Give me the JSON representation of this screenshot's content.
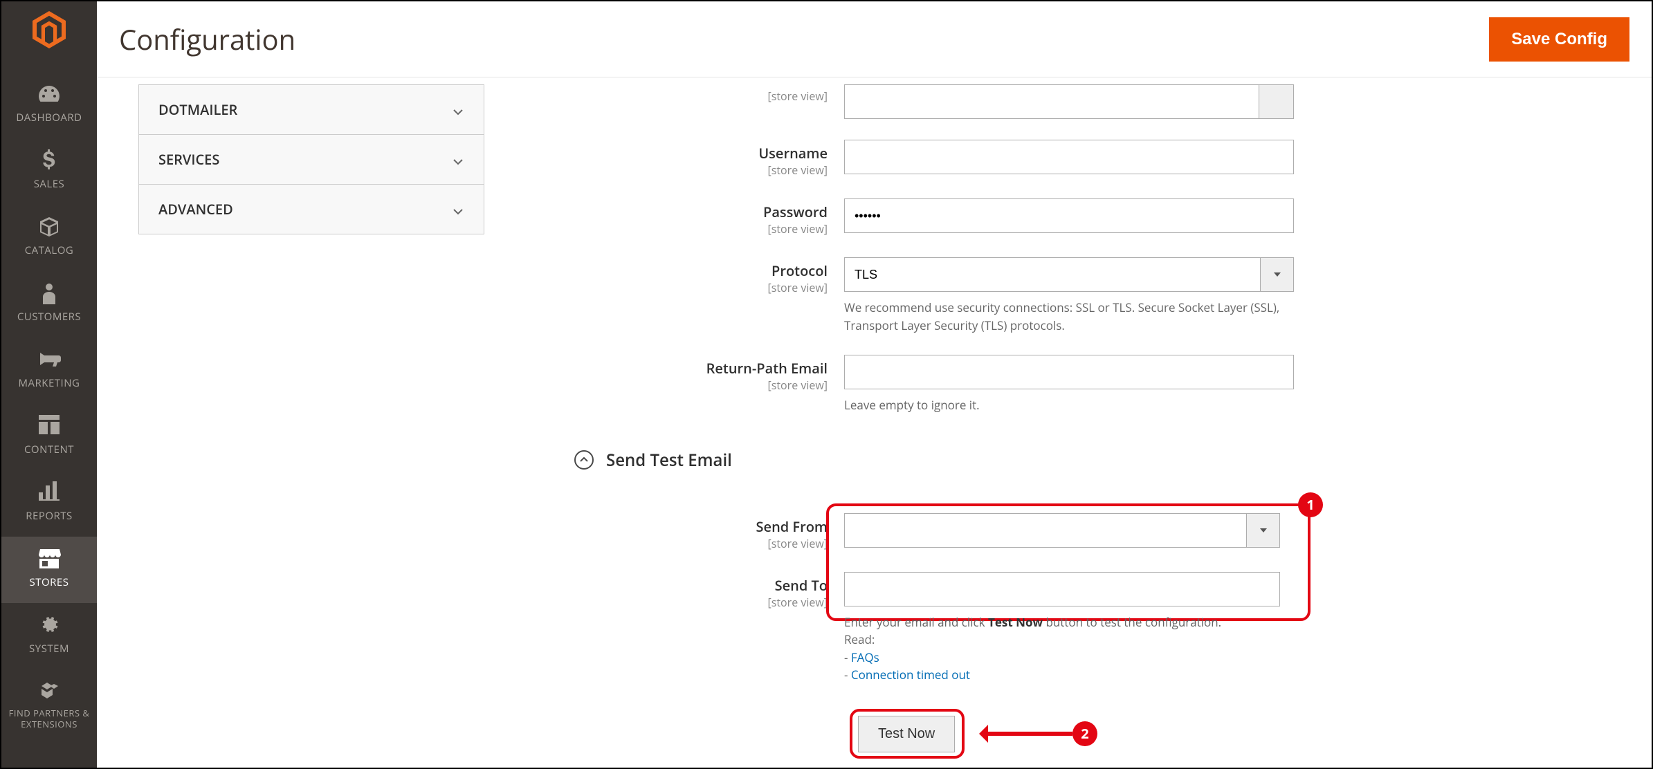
{
  "header": {
    "title": "Configuration",
    "save_button": "Save Config"
  },
  "sidebar": {
    "items": [
      {
        "key": "dashboard",
        "label": "DASHBOARD",
        "icon": "gauge"
      },
      {
        "key": "sales",
        "label": "SALES",
        "icon": "dollar"
      },
      {
        "key": "catalog",
        "label": "CATALOG",
        "icon": "cube"
      },
      {
        "key": "customers",
        "label": "CUSTOMERS",
        "icon": "person"
      },
      {
        "key": "marketing",
        "label": "MARKETING",
        "icon": "megaphone"
      },
      {
        "key": "content",
        "label": "CONTENT",
        "icon": "layout"
      },
      {
        "key": "reports",
        "label": "REPORTS",
        "icon": "bar-chart"
      },
      {
        "key": "stores",
        "label": "STORES",
        "icon": "storefront",
        "active": true
      },
      {
        "key": "system",
        "label": "SYSTEM",
        "icon": "gear"
      },
      {
        "key": "partners",
        "label": "FIND PARTNERS & EXTENSIONS",
        "icon": "blocks"
      }
    ]
  },
  "config_nav": {
    "sections": [
      {
        "label": "DOTMAILER"
      },
      {
        "label": "SERVICES"
      },
      {
        "label": "ADVANCED"
      }
    ]
  },
  "scope_label": "[store view]",
  "fields": {
    "field0": {
      "label": "",
      "value": ""
    },
    "username": {
      "label": "Username",
      "value": ""
    },
    "password": {
      "label": "Password",
      "value": "••••••"
    },
    "protocol": {
      "label": "Protocol",
      "value": "TLS",
      "help": "We recommend use security connections: SSL or TLS. Secure Socket Layer (SSL), Transport Layer Security (TLS) protocols."
    },
    "return_path": {
      "label": "Return-Path Email",
      "value": "",
      "help": "Leave empty to ignore it."
    }
  },
  "test_section": {
    "title": "Send Test Email",
    "send_from": {
      "label": "Send From",
      "value": ""
    },
    "send_to": {
      "label": "Send To",
      "help_prefix": "Enter your email and click ",
      "help_strong": "Test Now",
      "help_suffix": " button to test the configuration.",
      "read_label": "Read:",
      "link_faqs": "FAQs",
      "link_timeout": "Connection timed out"
    },
    "test_button": "Test Now"
  },
  "annotations": {
    "badge1": "1",
    "badge2": "2"
  }
}
